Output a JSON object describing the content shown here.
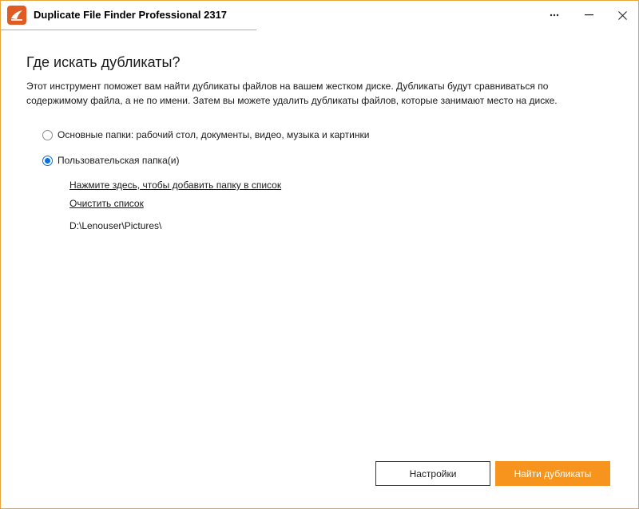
{
  "window": {
    "title": "Duplicate File Finder Professional 2317",
    "accent_color": "#f7941d",
    "border_color": "#e8a33c",
    "icons": {
      "app": "app-logo-icon",
      "more": "more-options-icon",
      "minimize": "minimize-icon",
      "close": "close-icon"
    }
  },
  "main": {
    "heading": "Где искать дубликаты?",
    "description": "Этот инструмент поможет вам найти дубликаты файлов на вашем жестком диске. Дубликаты будут сравниваться по содержимому файла, а не по имени. Затем вы можете удалить дубликаты файлов, которые занимают место на диске.",
    "options": [
      {
        "label": "Основные папки: рабочий стол, документы, видео, музыка и картинки",
        "selected": false
      },
      {
        "label": "Пользовательская папка(и)",
        "selected": true
      }
    ],
    "add_folder_link": "Нажмите здесь, чтобы добавить папку в список",
    "clear_list_link": "Очистить список",
    "folders": [
      "D:\\Lenouser\\Pictures\\"
    ]
  },
  "footer": {
    "settings_label": "Настройки",
    "find_label": "Найти дубликаты"
  }
}
